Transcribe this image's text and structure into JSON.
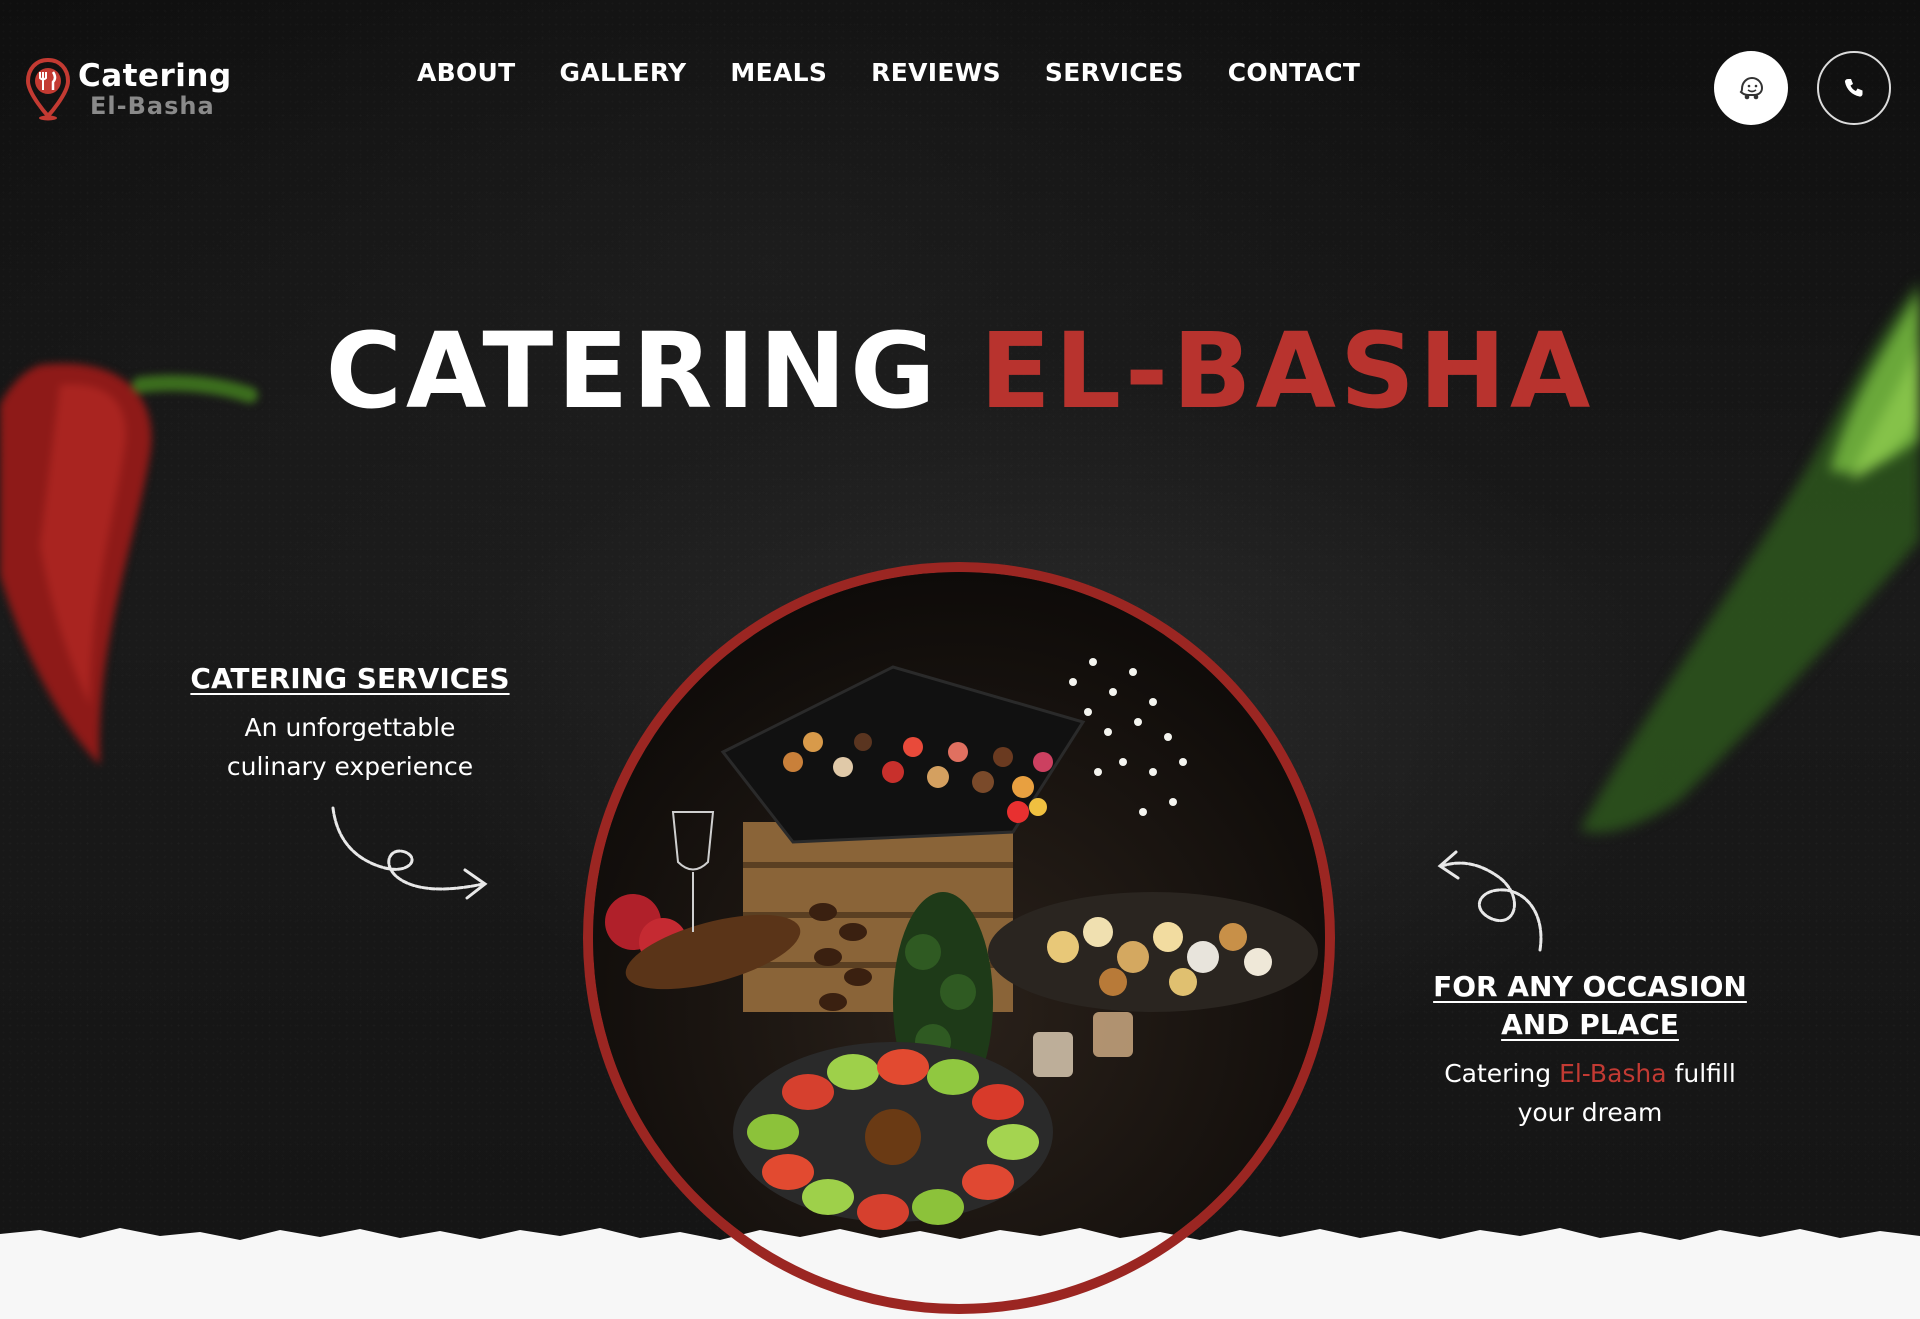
{
  "brand": {
    "name": "Catering",
    "subname": "El-Basha",
    "accent": "#b8332e",
    "logo_icon": "map-pin-cutlery-icon"
  },
  "nav": {
    "items": [
      {
        "label": "ABOUT"
      },
      {
        "label": "GALLERY"
      },
      {
        "label": "MEALS"
      },
      {
        "label": "REVIEWS"
      },
      {
        "label": "SERVICES"
      },
      {
        "label": "CONTACT"
      }
    ]
  },
  "header_buttons": {
    "waze_icon": "waze-icon",
    "phone_icon": "phone-icon"
  },
  "hero": {
    "title_white": "CATERING",
    "title_red": "EL-BASHA",
    "left": {
      "heading": "CATERING SERVICES",
      "line1": "An unforgettable",
      "line2": "culinary experience"
    },
    "right": {
      "heading_line1": "FOR ANY OCCASION",
      "heading_line2": "AND PLACE",
      "text_before": "Catering",
      "text_red": "El-Basha",
      "text_after": "fulfill",
      "line2": "your dream"
    }
  }
}
